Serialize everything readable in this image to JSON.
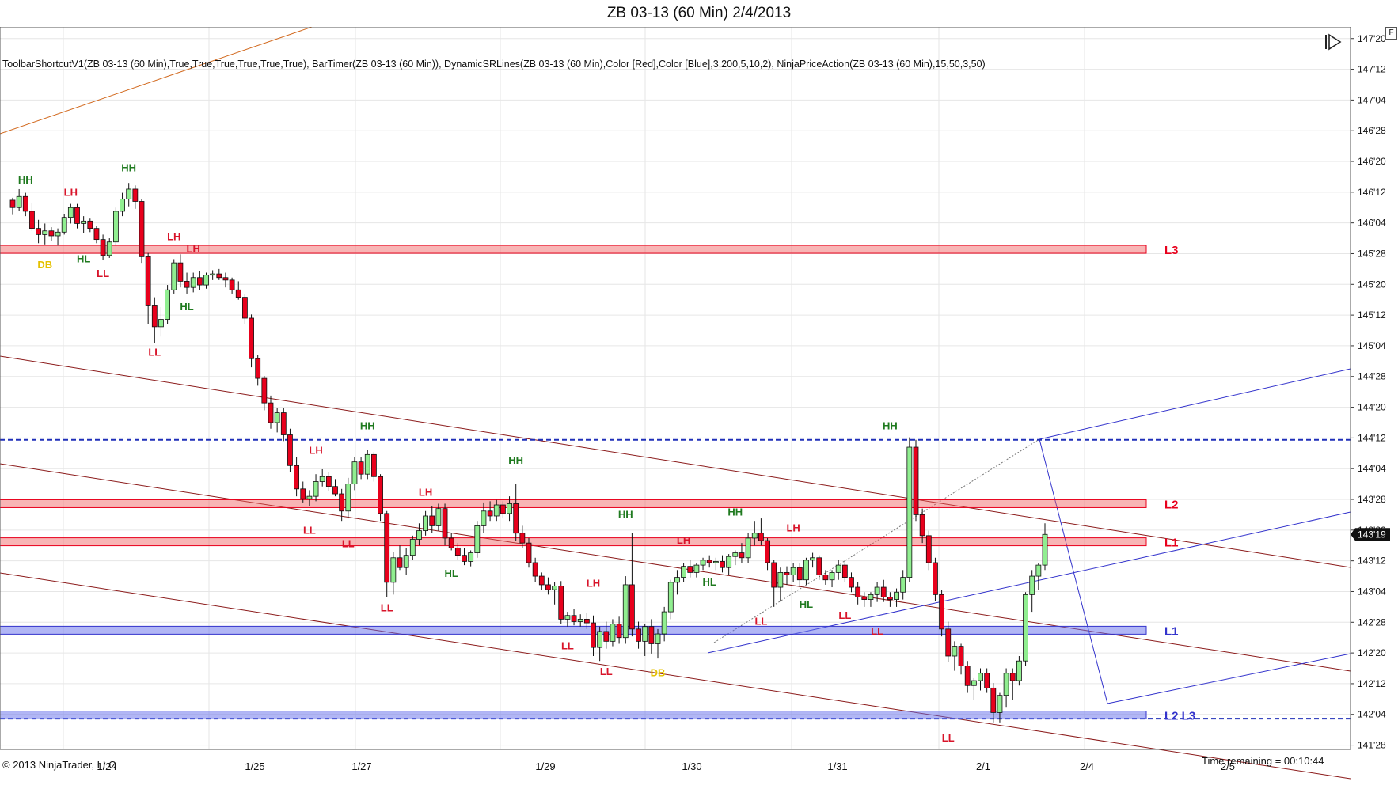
{
  "window": {
    "title": "ZB 03-13 (60 Min)  2/4/2013"
  },
  "indicators_line": "ToolbarShortcutV1(ZB  03-13  (60  Min),True,True,True,True,True,True),  BarTimer(ZB  03-13  (60  Min)),  DynamicSRLines(ZB  03-13  (60  Min),Color  [Red],Color  [Blue],3,200,5,10,2),  NinjaPriceAction(ZB  03-13  (60  Min),15,50,3,50)",
  "footer": {
    "copyright": "© 2013 NinjaTrader, LLC",
    "time_remaining": "Time remaining = 00:10:44"
  },
  "toolbar": {
    "panel_button": "F"
  },
  "colors": {
    "up_candle": "#90ee90",
    "down_candle": "#e8001c",
    "support": "#3333cc",
    "resistance": "#e8001c",
    "channel": "#8b1a1a",
    "trend_orange": "#d2691e"
  },
  "chart_data": {
    "type": "candlestick",
    "title": "ZB 03-13 (60 Min)  2/4/2013",
    "ylim": [
      141.84,
      147.72
    ],
    "y_tick_labels": [
      "147'20",
      "147'12",
      "147'04",
      "146'28",
      "146'20",
      "146'12",
      "146'04",
      "145'28",
      "145'20",
      "145'12",
      "145'04",
      "144'28",
      "144'20",
      "144'12",
      "144'04",
      "143'28",
      "143'20",
      "143'12",
      "143'04",
      "142'28",
      "142'20",
      "142'12",
      "142'04",
      "141'28"
    ],
    "y_tick_values": [
      147.625,
      147.375,
      147.125,
      146.875,
      146.625,
      146.375,
      146.125,
      145.875,
      145.625,
      145.375,
      145.125,
      144.875,
      144.625,
      144.375,
      144.125,
      143.875,
      143.625,
      143.375,
      143.125,
      142.875,
      142.625,
      142.375,
      142.125,
      141.875
    ],
    "x_labels": [
      "1/24",
      "1/25",
      "1/27",
      "1/29",
      "1/30",
      "1/31",
      "2/1",
      "2/4",
      "2/5"
    ],
    "last_price": "143'19",
    "grid": true,
    "resistance_zones": [
      {
        "label": "L3",
        "price": 145.91
      },
      {
        "label": "L2",
        "price": 143.84
      },
      {
        "label": "L1",
        "price": 143.53
      }
    ],
    "support_zones": [
      {
        "label": "L1",
        "price": 142.81
      },
      {
        "label": "L2 L3",
        "price": 142.12
      }
    ],
    "dashed_levels": [
      144.36,
      142.09
    ],
    "swing_labels": [
      {
        "text": "HH",
        "bar": 2,
        "price": 146.47,
        "color": "green"
      },
      {
        "text": "LH",
        "bar": 9,
        "price": 146.37,
        "color": "red"
      },
      {
        "text": "HH",
        "bar": 18,
        "price": 146.57,
        "color": "green"
      },
      {
        "text": "DB",
        "bar": 5,
        "price": 145.78,
        "color": "gold"
      },
      {
        "text": "HL",
        "bar": 11,
        "price": 145.83,
        "color": "green"
      },
      {
        "text": "LL",
        "bar": 14,
        "price": 145.71,
        "color": "red"
      },
      {
        "text": "LH",
        "bar": 25,
        "price": 146.01,
        "color": "red"
      },
      {
        "text": "LH",
        "bar": 28,
        "price": 145.91,
        "color": "red"
      },
      {
        "text": "HL",
        "bar": 27,
        "price": 145.44,
        "color": "green"
      },
      {
        "text": "LL",
        "bar": 22,
        "price": 145.07,
        "color": "red"
      },
      {
        "text": "LH",
        "bar": 47,
        "price": 144.27,
        "color": "red"
      },
      {
        "text": "HH",
        "bar": 55,
        "price": 144.47,
        "color": "green"
      },
      {
        "text": "LL",
        "bar": 46,
        "price": 143.62,
        "color": "red"
      },
      {
        "text": "LL",
        "bar": 52,
        "price": 143.51,
        "color": "red"
      },
      {
        "text": "LH",
        "bar": 64,
        "price": 143.93,
        "color": "red"
      },
      {
        "text": "HH",
        "bar": 78,
        "price": 144.19,
        "color": "green"
      },
      {
        "text": "HL",
        "bar": 68,
        "price": 143.27,
        "color": "green"
      },
      {
        "text": "LL",
        "bar": 58,
        "price": 142.99,
        "color": "red"
      },
      {
        "text": "HH",
        "bar": 95,
        "price": 143.75,
        "color": "green"
      },
      {
        "text": "LH",
        "bar": 90,
        "price": 143.19,
        "color": "red"
      },
      {
        "text": "LL",
        "bar": 86,
        "price": 142.68,
        "color": "red"
      },
      {
        "text": "LL",
        "bar": 92,
        "price": 142.47,
        "color": "red"
      },
      {
        "text": "DB",
        "bar": 100,
        "price": 142.46,
        "color": "gold"
      },
      {
        "text": "LH",
        "bar": 104,
        "price": 143.54,
        "color": "red"
      },
      {
        "text": "HL",
        "bar": 108,
        "price": 143.2,
        "color": "green"
      },
      {
        "text": "HH",
        "bar": 112,
        "price": 143.77,
        "color": "green"
      },
      {
        "text": "LH",
        "bar": 121,
        "price": 143.64,
        "color": "red"
      },
      {
        "text": "LL",
        "bar": 116,
        "price": 142.88,
        "color": "red"
      },
      {
        "text": "HL",
        "bar": 123,
        "price": 143.02,
        "color": "green"
      },
      {
        "text": "LL",
        "bar": 129,
        "price": 142.93,
        "color": "red"
      },
      {
        "text": "HH",
        "bar": 136,
        "price": 144.47,
        "color": "green"
      },
      {
        "text": "LL",
        "bar": 134,
        "price": 142.8,
        "color": "red"
      },
      {
        "text": "LL",
        "bar": 145,
        "price": 141.93,
        "color": "red"
      }
    ],
    "bars_ohlc": [
      [
        146.31,
        146.33,
        146.19,
        146.25
      ],
      [
        146.25,
        146.4,
        146.22,
        146.34
      ],
      [
        146.34,
        146.37,
        146.18,
        146.22
      ],
      [
        146.22,
        146.29,
        146.06,
        146.08
      ],
      [
        146.08,
        146.15,
        145.96,
        146.03
      ],
      [
        146.03,
        146.12,
        145.95,
        146.06
      ],
      [
        146.06,
        146.09,
        145.98,
        146.02
      ],
      [
        146.02,
        146.08,
        145.94,
        146.05
      ],
      [
        146.05,
        146.2,
        146.03,
        146.17
      ],
      [
        146.17,
        146.28,
        146.12,
        146.25
      ],
      [
        146.25,
        146.28,
        146.08,
        146.12
      ],
      [
        146.12,
        146.18,
        146.04,
        146.14
      ],
      [
        146.14,
        146.16,
        146.05,
        146.08
      ],
      [
        146.08,
        146.1,
        145.96,
        145.99
      ],
      [
        145.99,
        146.03,
        145.82,
        145.86
      ],
      [
        145.86,
        146.0,
        145.84,
        145.97
      ],
      [
        145.97,
        146.25,
        145.94,
        146.22
      ],
      [
        146.22,
        146.37,
        146.18,
        146.32
      ],
      [
        146.32,
        146.45,
        146.26,
        146.4
      ],
      [
        146.4,
        146.43,
        146.24,
        146.3
      ],
      [
        146.3,
        146.32,
        145.8,
        145.85
      ],
      [
        145.85,
        145.88,
        145.3,
        145.45
      ],
      [
        145.45,
        145.52,
        145.15,
        145.28
      ],
      [
        145.28,
        145.44,
        145.2,
        145.34
      ],
      [
        145.34,
        145.62,
        145.3,
        145.58
      ],
      [
        145.58,
        145.83,
        145.55,
        145.8
      ],
      [
        145.8,
        145.87,
        145.6,
        145.65
      ],
      [
        145.65,
        145.72,
        145.55,
        145.6
      ],
      [
        145.6,
        145.72,
        145.56,
        145.68
      ],
      [
        145.68,
        145.73,
        145.58,
        145.62
      ],
      [
        145.62,
        145.72,
        145.59,
        145.7
      ],
      [
        145.7,
        145.74,
        145.66,
        145.71
      ],
      [
        145.71,
        145.75,
        145.66,
        145.68
      ],
      [
        145.68,
        145.72,
        145.6,
        145.66
      ],
      [
        145.66,
        145.68,
        145.55,
        145.58
      ],
      [
        145.58,
        145.65,
        145.5,
        145.52
      ],
      [
        145.52,
        145.55,
        145.3,
        145.35
      ],
      [
        145.35,
        145.38,
        144.95,
        145.02
      ],
      [
        145.02,
        145.05,
        144.8,
        144.86
      ],
      [
        144.86,
        144.88,
        144.6,
        144.66
      ],
      [
        144.66,
        144.72,
        144.45,
        144.5
      ],
      [
        144.5,
        144.62,
        144.42,
        144.58
      ],
      [
        144.58,
        144.62,
        144.35,
        144.4
      ],
      [
        144.4,
        144.45,
        144.1,
        144.15
      ],
      [
        144.15,
        144.22,
        143.9,
        143.96
      ],
      [
        143.96,
        144.02,
        143.85,
        143.88
      ],
      [
        143.88,
        143.95,
        143.82,
        143.9
      ],
      [
        143.9,
        144.08,
        143.86,
        144.02
      ],
      [
        144.02,
        144.12,
        143.98,
        144.06
      ],
      [
        144.06,
        144.1,
        143.94,
        143.98
      ],
      [
        143.98,
        144.04,
        143.9,
        143.92
      ],
      [
        143.92,
        143.96,
        143.7,
        143.78
      ],
      [
        143.78,
        144.05,
        143.72,
        144.0
      ],
      [
        144.0,
        144.22,
        143.95,
        144.18
      ],
      [
        144.18,
        144.22,
        144.04,
        144.08
      ],
      [
        144.08,
        144.28,
        144.04,
        144.24
      ],
      [
        144.24,
        144.26,
        144.02,
        144.06
      ],
      [
        144.06,
        144.08,
        143.7,
        143.76
      ],
      [
        143.76,
        143.78,
        143.08,
        143.2
      ],
      [
        143.2,
        143.45,
        143.1,
        143.4
      ],
      [
        143.4,
        143.5,
        143.3,
        143.32
      ],
      [
        143.32,
        143.48,
        143.26,
        143.42
      ],
      [
        143.42,
        143.58,
        143.38,
        143.55
      ],
      [
        143.55,
        143.68,
        143.5,
        143.62
      ],
      [
        143.62,
        143.78,
        143.58,
        143.74
      ],
      [
        143.74,
        143.82,
        143.6,
        143.66
      ],
      [
        143.66,
        143.84,
        143.62,
        143.8
      ],
      [
        143.8,
        143.84,
        143.5,
        143.56
      ],
      [
        143.56,
        143.6,
        143.46,
        143.48
      ],
      [
        143.48,
        143.52,
        143.38,
        143.42
      ],
      [
        143.42,
        143.48,
        143.34,
        143.37
      ],
      [
        143.37,
        143.46,
        143.33,
        143.44
      ],
      [
        143.44,
        143.7,
        143.4,
        143.66
      ],
      [
        143.66,
        143.85,
        143.6,
        143.78
      ],
      [
        143.78,
        143.86,
        143.7,
        143.74
      ],
      [
        143.74,
        143.87,
        143.7,
        143.83
      ],
      [
        143.83,
        143.86,
        143.72,
        143.76
      ],
      [
        143.76,
        143.9,
        143.7,
        143.84
      ],
      [
        143.84,
        144.0,
        143.54,
        143.6
      ],
      [
        143.6,
        143.66,
        143.48,
        143.52
      ],
      [
        143.52,
        143.56,
        143.32,
        143.36
      ],
      [
        143.36,
        143.4,
        143.2,
        143.25
      ],
      [
        143.25,
        143.28,
        143.14,
        143.18
      ],
      [
        143.18,
        143.24,
        143.1,
        143.14
      ],
      [
        143.14,
        143.2,
        143.02,
        143.17
      ],
      [
        143.17,
        143.21,
        142.86,
        142.9
      ],
      [
        142.9,
        142.96,
        142.84,
        142.93
      ],
      [
        142.93,
        142.98,
        142.85,
        142.88
      ],
      [
        142.88,
        142.94,
        142.84,
        142.9
      ],
      [
        142.9,
        142.95,
        142.82,
        142.87
      ],
      [
        142.87,
        142.93,
        142.6,
        142.67
      ],
      [
        142.67,
        142.84,
        142.56,
        142.8
      ],
      [
        142.8,
        142.88,
        142.66,
        142.72
      ],
      [
        142.72,
        142.9,
        142.68,
        142.86
      ],
      [
        142.86,
        142.92,
        142.7,
        142.75
      ],
      [
        142.75,
        143.25,
        142.7,
        143.18
      ],
      [
        143.18,
        143.6,
        142.76,
        142.82
      ],
      [
        142.82,
        142.88,
        142.66,
        142.72
      ],
      [
        142.72,
        142.86,
        142.6,
        142.84
      ],
      [
        142.84,
        142.9,
        142.62,
        142.7
      ],
      [
        142.7,
        142.82,
        142.58,
        142.78
      ],
      [
        142.78,
        143.0,
        142.72,
        142.96
      ],
      [
        142.96,
        143.22,
        142.9,
        143.2
      ],
      [
        143.2,
        143.3,
        143.1,
        143.24
      ],
      [
        143.24,
        143.36,
        143.2,
        143.33
      ],
      [
        143.33,
        143.38,
        143.24,
        143.28
      ],
      [
        143.28,
        143.36,
        143.24,
        143.34
      ],
      [
        143.34,
        143.4,
        143.3,
        143.38
      ],
      [
        143.38,
        143.42,
        143.32,
        143.36
      ],
      [
        143.36,
        143.4,
        143.3,
        143.37
      ],
      [
        143.37,
        143.42,
        143.28,
        143.32
      ],
      [
        143.32,
        143.43,
        143.26,
        143.41
      ],
      [
        143.41,
        143.46,
        143.34,
        143.44
      ],
      [
        143.44,
        143.52,
        143.36,
        143.4
      ],
      [
        143.4,
        143.6,
        143.36,
        143.56
      ],
      [
        143.56,
        143.7,
        143.5,
        143.6
      ],
      [
        143.6,
        143.72,
        143.5,
        143.54
      ],
      [
        143.54,
        143.56,
        143.3,
        143.36
      ],
      [
        143.36,
        143.38,
        143.0,
        143.16
      ],
      [
        143.16,
        143.32,
        143.05,
        143.28
      ],
      [
        143.28,
        143.33,
        143.18,
        143.26
      ],
      [
        143.26,
        143.36,
        143.2,
        143.32
      ],
      [
        143.32,
        143.36,
        143.16,
        143.22
      ],
      [
        143.22,
        143.4,
        143.18,
        143.38
      ],
      [
        143.38,
        143.44,
        143.32,
        143.4
      ],
      [
        143.4,
        143.42,
        143.22,
        143.26
      ],
      [
        143.26,
        143.3,
        143.18,
        143.22
      ],
      [
        143.22,
        143.3,
        143.16,
        143.28
      ],
      [
        143.28,
        143.38,
        143.22,
        143.34
      ],
      [
        143.34,
        143.38,
        143.2,
        143.24
      ],
      [
        143.24,
        143.28,
        143.12,
        143.16
      ],
      [
        143.16,
        143.2,
        143.02,
        143.08
      ],
      [
        143.08,
        143.12,
        143.0,
        143.06
      ],
      [
        143.06,
        143.12,
        143.0,
        143.1
      ],
      [
        143.1,
        143.2,
        143.04,
        143.16
      ],
      [
        143.16,
        143.22,
        143.04,
        143.08
      ],
      [
        143.08,
        143.12,
        143.0,
        143.06
      ],
      [
        143.06,
        143.15,
        143.0,
        143.12
      ],
      [
        143.12,
        143.3,
        143.06,
        143.24
      ],
      [
        143.24,
        144.38,
        143.2,
        144.3
      ],
      [
        144.3,
        144.36,
        143.7,
        143.75
      ],
      [
        143.75,
        143.8,
        143.52,
        143.58
      ],
      [
        143.58,
        143.62,
        143.3,
        143.36
      ],
      [
        143.36,
        143.4,
        143.05,
        143.1
      ],
      [
        143.1,
        143.14,
        142.76,
        142.82
      ],
      [
        142.82,
        142.88,
        142.55,
        142.6
      ],
      [
        142.6,
        142.72,
        142.48,
        142.68
      ],
      [
        142.68,
        142.7,
        142.45,
        142.52
      ],
      [
        142.52,
        142.56,
        142.3,
        142.36
      ],
      [
        142.36,
        142.42,
        142.24,
        142.4
      ],
      [
        142.4,
        142.5,
        142.32,
        142.46
      ],
      [
        142.46,
        142.5,
        142.3,
        142.34
      ],
      [
        142.34,
        142.38,
        142.06,
        142.14
      ],
      [
        142.14,
        142.3,
        142.06,
        142.28
      ],
      [
        142.28,
        142.5,
        142.18,
        142.46
      ],
      [
        142.46,
        142.5,
        142.24,
        142.4
      ],
      [
        142.4,
        142.6,
        142.36,
        142.56
      ],
      [
        142.56,
        143.12,
        142.52,
        143.1
      ],
      [
        143.1,
        143.3,
        142.96,
        143.25
      ],
      [
        143.25,
        143.36,
        143.14,
        143.34
      ],
      [
        143.34,
        143.68,
        143.3,
        143.59
      ]
    ]
  }
}
